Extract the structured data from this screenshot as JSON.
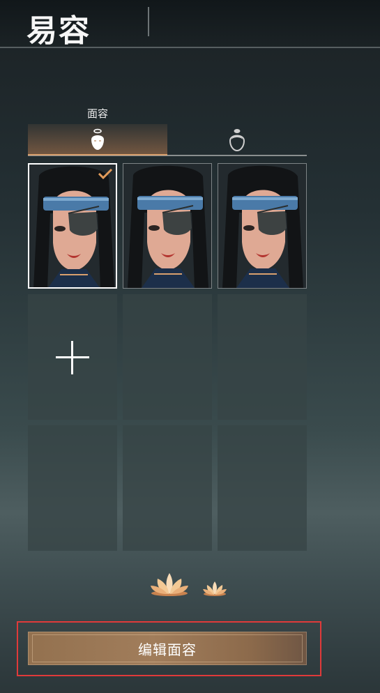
{
  "header": {
    "title": "易容"
  },
  "tabs": {
    "active_label": "面容",
    "items": [
      {
        "icon": "face-head-icon",
        "active": true
      },
      {
        "icon": "hair-head-icon",
        "active": false
      }
    ]
  },
  "presets": {
    "slots": [
      {
        "kind": "portrait",
        "selected": true
      },
      {
        "kind": "portrait",
        "selected": false
      },
      {
        "kind": "portrait",
        "selected": false
      },
      {
        "kind": "add"
      },
      {
        "kind": "empty"
      },
      {
        "kind": "empty"
      },
      {
        "kind": "empty"
      },
      {
        "kind": "empty"
      },
      {
        "kind": "empty"
      }
    ]
  },
  "actions": {
    "edit_face_label": "编辑面容"
  },
  "colors": {
    "accent": "#d9a06e",
    "highlight": "#e03a3a",
    "button": "#93714f"
  }
}
